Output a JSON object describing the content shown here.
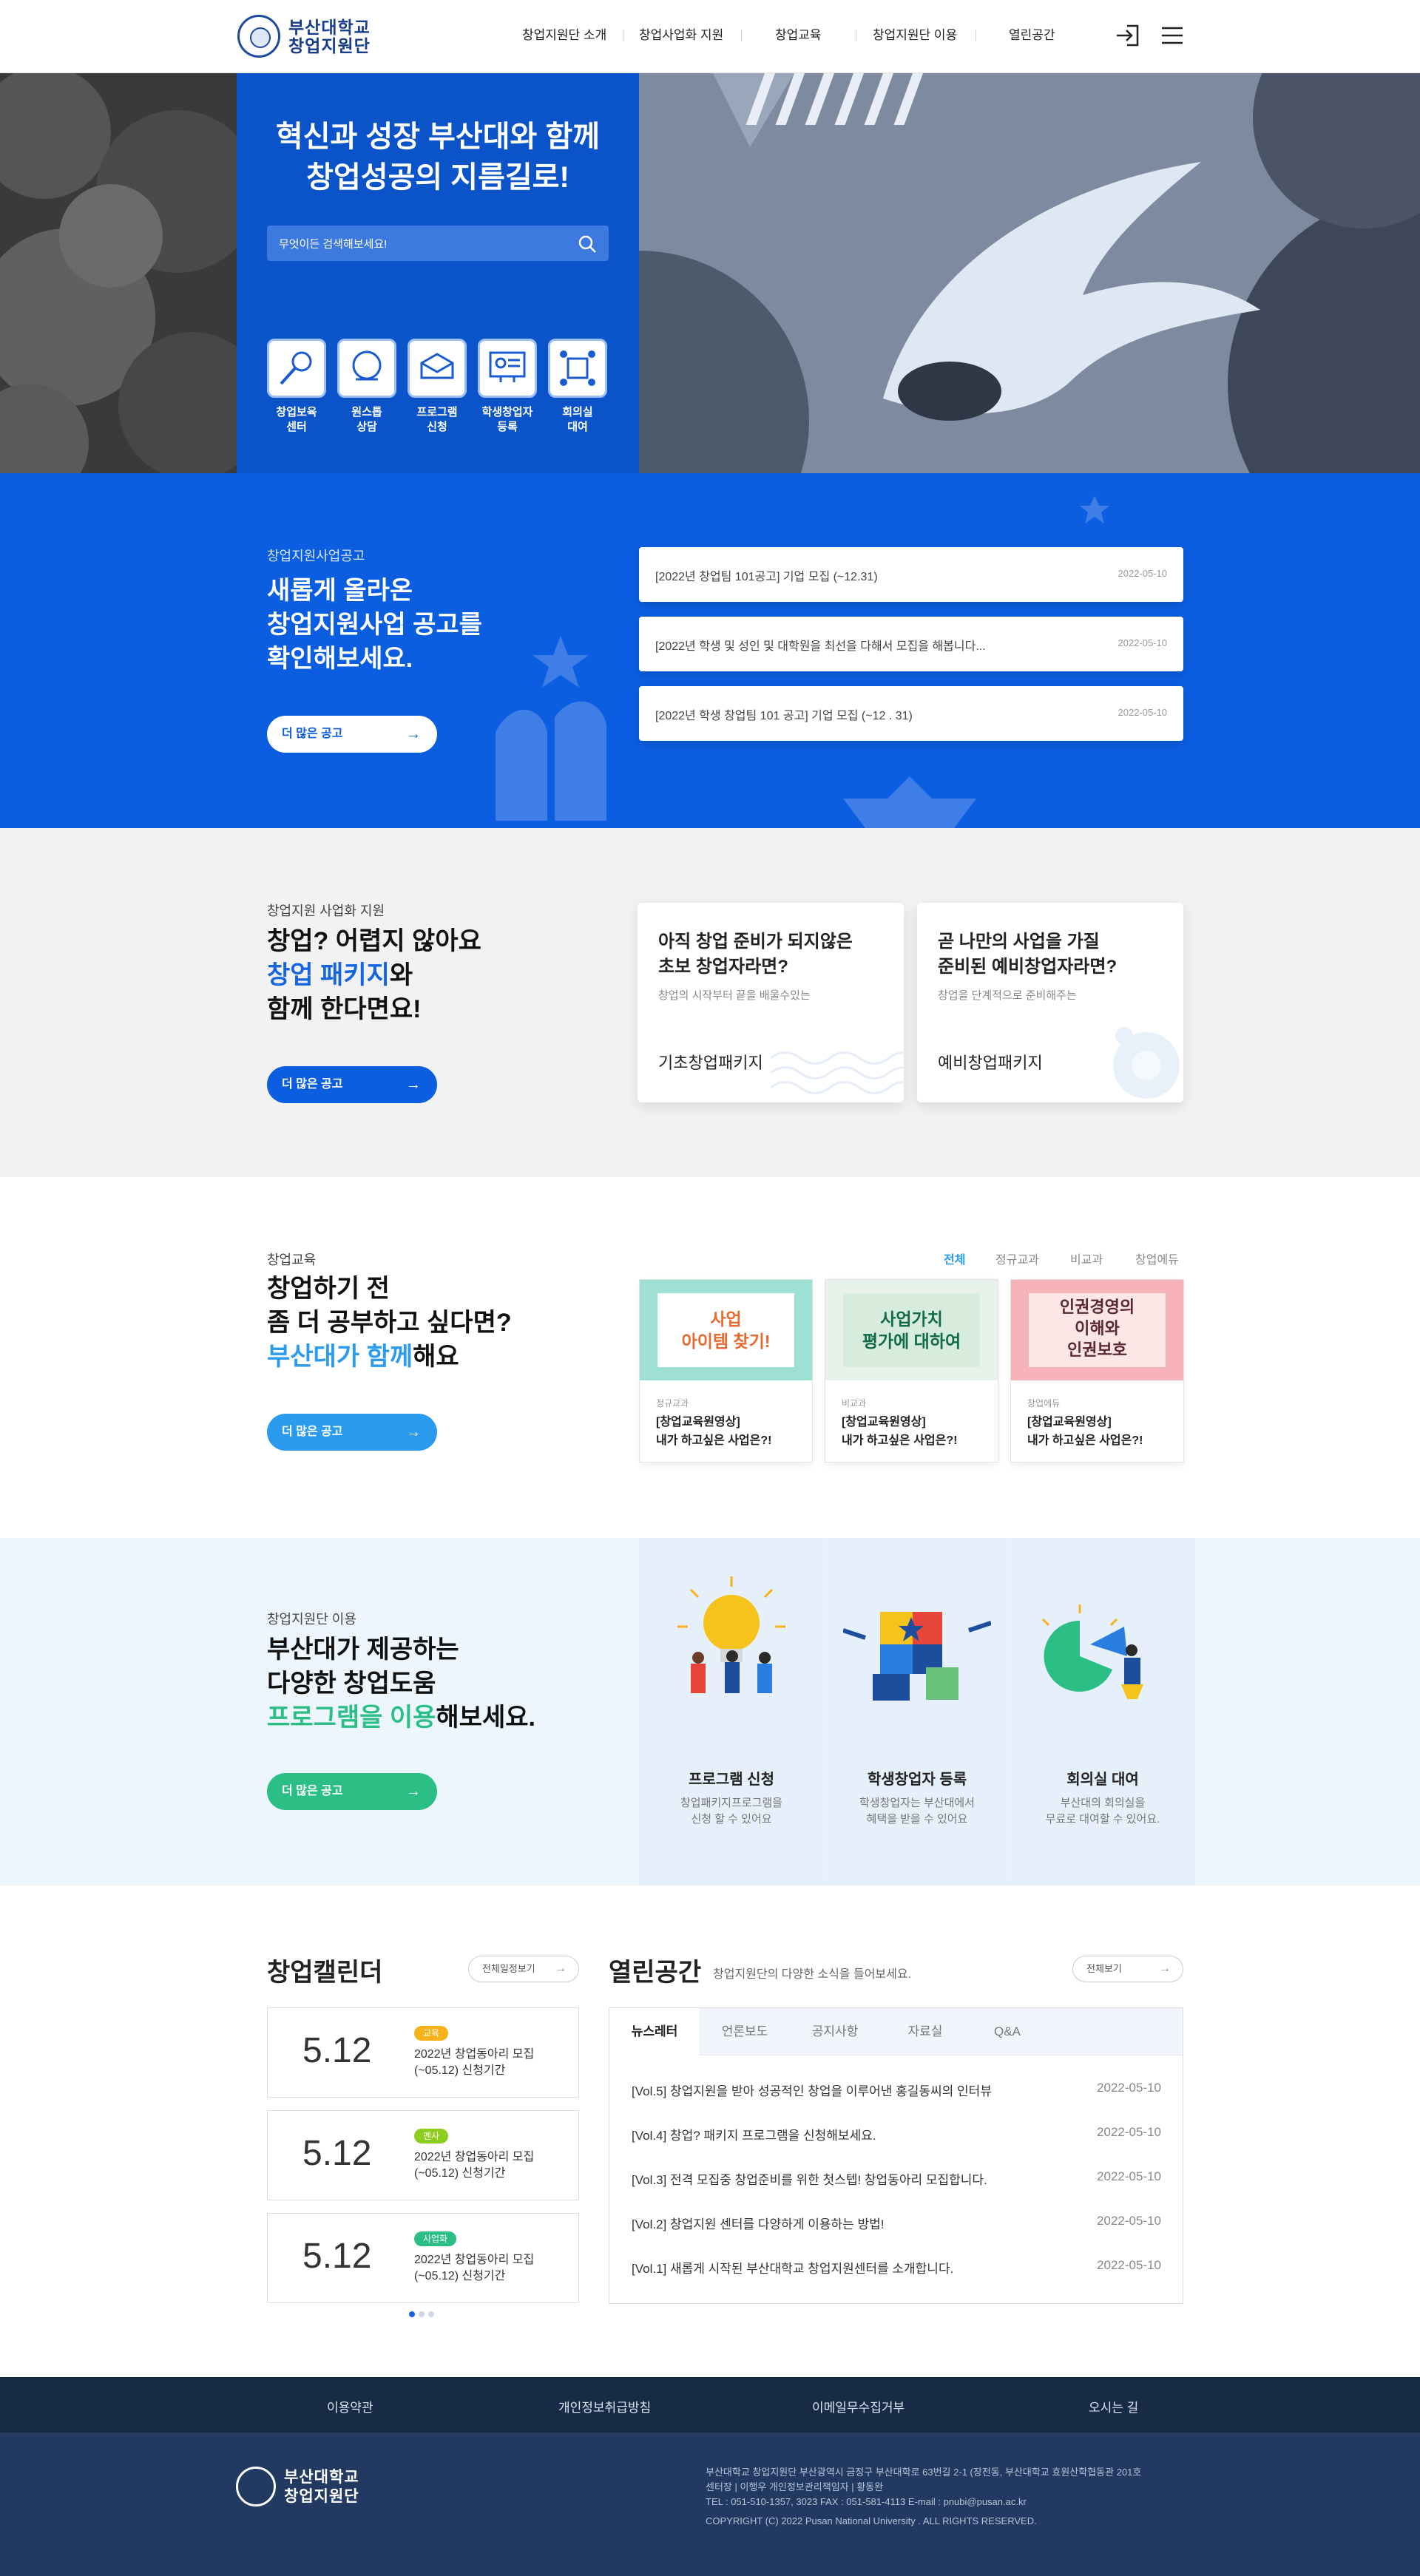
{
  "header": {
    "logo_line1": "부산대학교",
    "logo_line2": "창업지원단",
    "nav": [
      "창업지원단 소개",
      "창업사업화 지원",
      "창업교육",
      "창업지원단 이용",
      "열린공간"
    ]
  },
  "hero": {
    "title_line1": "혁신과 성장 부산대와 함께",
    "title_line2": "창업성공의 지름길로!",
    "search_placeholder": "무엇이든 검색해보세요!",
    "quick_links": [
      {
        "label1": "창업보육",
        "label2": "센터",
        "icon": "incubator-icon"
      },
      {
        "label1": "원스톱",
        "label2": "상담",
        "icon": "consult-icon"
      },
      {
        "label1": "프로그램",
        "label2": "신청",
        "icon": "program-icon"
      },
      {
        "label1": "학생창업자",
        "label2": "등록",
        "icon": "student-register-icon"
      },
      {
        "label1": "회의실",
        "label2": "대여",
        "icon": "meeting-room-icon"
      }
    ]
  },
  "notice": {
    "small": "창업지원사업공고",
    "big_line1": "새롭게 올라온",
    "big_line2": "창업지원사업 공고를",
    "big_line3": "확인해보세요.",
    "more": "더 많은 공고",
    "items": [
      {
        "title": "[2022년 창업팀 101공고] 기업 모집 (~12.31)",
        "date": "2022-05-10"
      },
      {
        "title": "[2022년 학생 및 성인 및 대학원을 최선을 다해서 모집을 해봅니다...",
        "date": "2022-05-10"
      },
      {
        "title": "[2022년 학생 창업팀 101 공고] 기업 모집 (~12 . 31)",
        "date": "2022-05-10"
      }
    ]
  },
  "package": {
    "small": "창업지원 사업화 지원",
    "big_line1": "창업? 어렵지 않아요",
    "big_highlight": "창업 패키지",
    "big_rest": "와",
    "big_line3": "함께 한다면요!",
    "more": "더 많은 공고",
    "cards": [
      {
        "title1": "아직 창업 준비가 되지않은",
        "title2": "초보 창업자라면?",
        "desc": "창업의 시작부터 끝을 배울수있는",
        "name": "기초창업패키지"
      },
      {
        "title1": "곧 나만의 사업을 가질",
        "title2": "준비된 예비창업자라면?",
        "desc": "창업을 단계적으로 준비해주는",
        "name": "예비창업패키지"
      }
    ]
  },
  "education": {
    "small": "창업교육",
    "big_line1": "창업하기 전",
    "big_line2": "좀 더 공부하고 싶다면?",
    "big_highlight": "부산대가 함께",
    "big_rest": "해요",
    "more": "더 많은 공고",
    "tabs": [
      "전체",
      "정규교과",
      "비교과",
      "창업에듀"
    ],
    "cards": [
      {
        "thumb1": "사업",
        "thumb2": "아이템 찾기!",
        "tag": "정규교과",
        "title1": "[창업교육원영상]",
        "title2": "내가 하고싶은 사업은?!"
      },
      {
        "thumb1": "사업가치",
        "thumb2": "평가에 대하여",
        "tag": "비교과",
        "title1": "[창업교육원영상]",
        "title2": "내가 하고싶은 사업은?!"
      },
      {
        "thumb1": "인권경영의",
        "thumb2": "이해와",
        "thumb3": "인권보호",
        "tag": "창업에듀",
        "title1": "[창업교육원영상]",
        "title2": "내가 하고싶은 사업은?!"
      }
    ]
  },
  "usage": {
    "small": "창업지원단 이용",
    "big_line1": "부산대가 제공하는",
    "big_line2": "다양한 창업도움",
    "big_highlight": "프로그램을 이용",
    "big_rest": "해보세요.",
    "more": "더 많은 공고",
    "cards": [
      {
        "title": "프로그램 신청",
        "desc1": "창업패키지프로그램을",
        "desc2": "신청 할 수 있어요"
      },
      {
        "title": "학생창업자 등록",
        "desc1": "학생창업자는 부산대에서",
        "desc2": "혜택을 받을 수 있어요"
      },
      {
        "title": "회의실 대여",
        "desc1": "부산대의 회의실을",
        "desc2": "무료로 대여할 수 있어요."
      }
    ]
  },
  "calendar": {
    "title": "창업캘린더",
    "view_all": "전체일정보기",
    "items": [
      {
        "date": "5.12",
        "badge": "교육",
        "badge_color": "#f5b21a",
        "text1": "2022년 창업동아리 모집",
        "text2": "(~05.12) 신청기간"
      },
      {
        "date": "5.12",
        "badge": "멘사",
        "badge_color": "#8ccd1e",
        "text1": "2022년 창업동아리 모집",
        "text2": "(~05.12) 신청기간"
      },
      {
        "date": "5.12",
        "badge": "사업화",
        "badge_color": "#2bbf86",
        "text1": "2022년 창업동아리 모집",
        "text2": "(~05.12) 신청기간"
      }
    ]
  },
  "board": {
    "title": "열린공간",
    "subtitle": "창업지원단의 다양한 소식을 들어보세요.",
    "view_all": "전체보기",
    "tabs": [
      "뉴스레터",
      "언론보도",
      "공지사항",
      "자료실",
      "Q&A"
    ],
    "rows": [
      {
        "title": "[Vol.5] 창업지원을 받아 성공적인 창업을 이루어낸 홍길동씨의 인터뷰",
        "date": "2022-05-10"
      },
      {
        "title": "[Vol.4] 창업? 패키지 프로그램을 신청해보세요.",
        "date": "2022-05-10"
      },
      {
        "title": "[Vol.3] 전격 모집중 창업준비를 위한 첫스텝! 창업동아리 모집합니다.",
        "date": "2022-05-10"
      },
      {
        "title": "[Vol.2] 창업지원 센터를 다양하게 이용하는 방법!",
        "date": "2022-05-10"
      },
      {
        "title": "[Vol.1] 새롭게 시작된 부산대학교 창업지원센터를 소개합니다.",
        "date": "2022-05-10"
      }
    ]
  },
  "footer": {
    "links": [
      "이용약관",
      "개인정보취급방침",
      "이메일무수집거부",
      "오시는 길"
    ],
    "logo_line1": "부산대학교",
    "logo_line2": "창업지원단",
    "info1": "부산대학교 창업지원단    부산광역시 금정구 부산대학로 63번길 2-1 (장전동, 부산대학교 효원산학협동관 201호",
    "info2": "센터장 | 이행우    개인정보관리책임자 | 황동완",
    "info3": "TEL : 051-510-1357, 3023   FAX : 051-581-4113    E-mail : pnubi@pusan.ac.kr",
    "copyright": "COPYRIGHT (C) 2022 Pusan National University . ALL RIGHTS RESERVED."
  },
  "colors": {
    "primary": "#0b5ee0",
    "hero_box": "#0b53c9",
    "education": "#2b9bf0",
    "usage": "#2bbf86",
    "footer": "#223a61"
  }
}
